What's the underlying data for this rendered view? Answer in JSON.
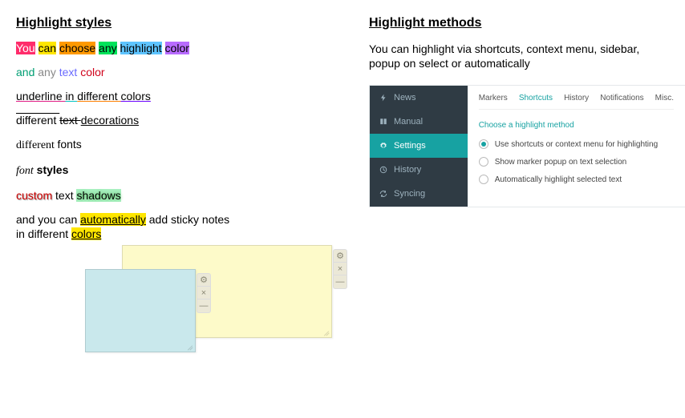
{
  "left": {
    "heading": "Highlight styles",
    "line1": [
      {
        "text": "You",
        "bg": "#ff2c6b",
        "color": "#fff"
      },
      {
        "text": " "
      },
      {
        "text": "can",
        "bg": "#ffe600"
      },
      {
        "text": " "
      },
      {
        "text": "choose",
        "bg": "#ff9900"
      },
      {
        "text": " "
      },
      {
        "text": "any",
        "bg": "#00e35a"
      },
      {
        "text": " "
      },
      {
        "text": "highlight",
        "bg": "#5ec4ff"
      },
      {
        "text": " "
      },
      {
        "text": "color",
        "bg": "#b86bff"
      }
    ],
    "line2": [
      {
        "text": "and",
        "color": "#009e73"
      },
      {
        "text": " "
      },
      {
        "text": "any",
        "color": "#888"
      },
      {
        "text": " "
      },
      {
        "text": "text",
        "color": "#6a6bff"
      },
      {
        "text": " "
      },
      {
        "text": "color",
        "color": "#d0021b"
      }
    ],
    "line3": [
      {
        "text": "underline ",
        "underline": true,
        "ucolor": "#e01b84"
      },
      {
        "text": "in ",
        "underline": true,
        "ucolor": "#00c3c3"
      },
      {
        "text": "different ",
        "underline": true,
        "ucolor": "#ff7f00"
      },
      {
        "text": "colors",
        "underline": true,
        "ucolor": "#6a00ff"
      }
    ],
    "line4": [
      {
        "text": "different ",
        "overline": true
      },
      {
        "text": "text ",
        "strike": true
      },
      {
        "text": "decorations",
        "underline": true,
        "ucolor": "#000"
      }
    ],
    "line5": [
      {
        "text": "different ",
        "font": "Georgia, serif"
      },
      {
        "text": "fonts",
        "font": "Arial, sans-serif"
      }
    ],
    "line6": [
      {
        "text": "font",
        "italic": true,
        "font": "Georgia, serif"
      },
      {
        "text": " "
      },
      {
        "text": "styles",
        "bold": true
      }
    ],
    "line7": [
      {
        "text": "custom",
        "color": "#c00",
        "shadow": "1px 1px 1px rgba(0,0,0,.4)"
      },
      {
        "text": " "
      },
      {
        "text": "text "
      },
      {
        "text": "shadows",
        "bg": "#a8f0c0",
        "shadow": "0 0 4px #4caf50"
      }
    ],
    "line8a": [
      {
        "text": "and you can "
      },
      {
        "text": "automatically",
        "bg": "#ffe600",
        "underline": true,
        "ucolor": "#000"
      },
      {
        "text": " add sticky notes"
      }
    ],
    "line8b": [
      {
        "text": "in different "
      },
      {
        "text": "colors",
        "bg": "#ffe600",
        "underline": true,
        "ucolor": "#000"
      }
    ]
  },
  "right": {
    "heading": "Highlight methods",
    "desc": "You can highlight via shortcuts, context menu, sidebar, popup on select or automatically",
    "sidebar": [
      {
        "label": "News",
        "icon": "bolt"
      },
      {
        "label": "Manual",
        "icon": "book"
      },
      {
        "label": "Settings",
        "icon": "gear",
        "active": true
      },
      {
        "label": "History",
        "icon": "clock"
      },
      {
        "label": "Syncing",
        "icon": "sync"
      }
    ],
    "tabs": [
      "Markers",
      "Shortcuts",
      "History",
      "Notifications",
      "Misc."
    ],
    "activeTab": "Shortcuts",
    "section_title": "Choose a highlight method",
    "options": [
      {
        "label": "Use shortcuts or context menu for highlighting",
        "checked": true
      },
      {
        "label": "Show marker popup on text selection",
        "checked": false
      },
      {
        "label": "Automatically highlight selected text",
        "checked": false
      }
    ]
  },
  "notes": {
    "ctrl_gear": "⚙",
    "ctrl_close": "×",
    "ctrl_min": "—"
  }
}
